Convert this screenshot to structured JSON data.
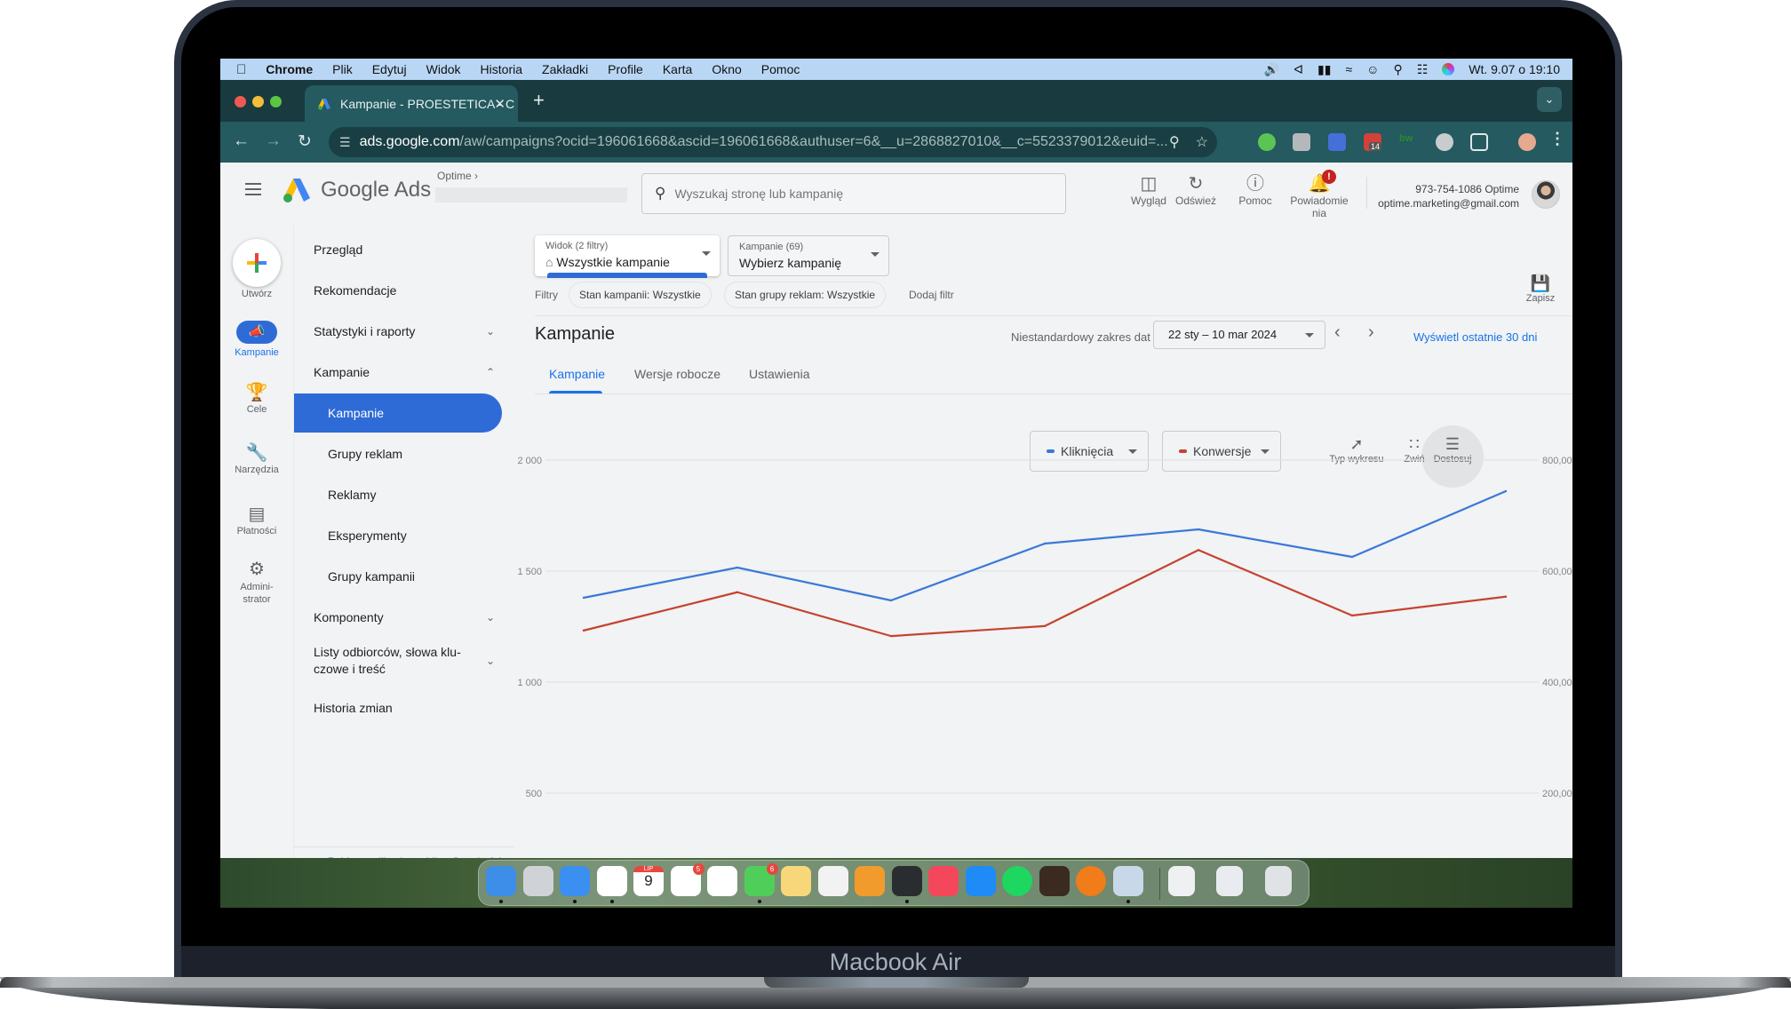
{
  "device": {
    "label": "Macbook Air"
  },
  "menubar": {
    "app": "Chrome",
    "items": [
      "Plik",
      "Edytuj",
      "Widok",
      "Historia",
      "Zakładki",
      "Profile",
      "Karta",
      "Okno",
      "Pomoc"
    ],
    "clock": "Wt. 9.07 o 19:10",
    "status_icons": [
      "volume-icon",
      "bluetooth-icon",
      "battery-icon",
      "wifi-icon",
      "user-icon",
      "spotlight-icon",
      "control-center-icon",
      "siri-icon"
    ]
  },
  "browser": {
    "tab_title": "Kampanie - PROESTETICA - C",
    "url_domain": "ads.google.com",
    "url_rest": "/aw/campaigns?ocid=196061668&ascid=196061668&authuser=6&__u=2868827010&__c=5523379012&euid=...",
    "extension_badge": "14"
  },
  "ads_header": {
    "product": "Google Ads",
    "account_label": "Optime",
    "search_placeholder": "Wyszukaj stronę lub kampanię",
    "buttons": [
      {
        "label": "Wygląd",
        "icon": "appearance-icon"
      },
      {
        "label": "Odśwież",
        "icon": "refresh-icon"
      },
      {
        "label": "Pomoc",
        "icon": "help-icon"
      },
      {
        "label": "Powiadomienia",
        "label_line1": "Powiadomie",
        "label_line2": "nia",
        "icon": "bell-icon",
        "badge": "!"
      }
    ],
    "user_line1": "973-754-1086 Optime",
    "user_email": "optime.marketing@gmail.com"
  },
  "rail": {
    "items": [
      {
        "label": "Utwórz",
        "icon": "create-plus-icon"
      },
      {
        "label": "Kampanie",
        "icon": "megaphone-icon",
        "active": true
      },
      {
        "label": "Cele",
        "icon": "trophy-icon"
      },
      {
        "label": "Narzędzia",
        "icon": "tools-icon"
      },
      {
        "label": "Płatności",
        "icon": "credit-card-icon"
      },
      {
        "label_line1": "Admini-",
        "label_line2": "strator",
        "icon": "gear-icon"
      }
    ]
  },
  "nav": {
    "items": [
      {
        "label": "Przegląd"
      },
      {
        "label": "Rekomendacje"
      },
      {
        "label": "Statystyki i raporty",
        "chevron": "down"
      },
      {
        "label": "Kampanie",
        "chevron": "up"
      },
      {
        "label": "Kampanie",
        "sub": true,
        "active": true
      },
      {
        "label": "Grupy reklam",
        "sub": true
      },
      {
        "label": "Reklamy",
        "sub": true
      },
      {
        "label": "Eksperymenty",
        "sub": true
      },
      {
        "label": "Grupy kampanii",
        "sub": true
      },
      {
        "label": "Komponenty",
        "chevron": "down"
      },
      {
        "label_line1": "Listy odbiorców, słowa klu-",
        "label_line2": "czowe i treść",
        "chevron": "down"
      },
      {
        "label": "Historia zmian"
      }
    ],
    "mobile_app_link": "Pobierz aplikację mobilną Google Ads"
  },
  "main": {
    "view_selector": {
      "label": "Widok (2 filtry)",
      "value": "Wszystkie kampanie"
    },
    "campaign_selector": {
      "label": "Kampanie (69)",
      "value": "Wybierz kampanię"
    },
    "filters_label": "Filtry",
    "filter_chips": [
      "Stan kampanii: Wszystkie",
      "Stan grupy reklam: Wszystkie"
    ],
    "add_filter": "Dodaj filtr",
    "save_label": "Zapisz",
    "page_title": "Kampanie",
    "date_range_label": "Niestandardowy zakres dat",
    "date_range_value": "22 sty – 10 mar 2024",
    "last_30_link": "Wyświetl ostatnie 30 dni",
    "tabs": [
      {
        "label": "Kampanie",
        "active": true
      },
      {
        "label": "Wersje robocze"
      },
      {
        "label": "Ustawienia"
      }
    ],
    "metrics": [
      {
        "label": "Kliknięcia",
        "color": "#3b78d8"
      },
      {
        "label": "Konwersje",
        "color": "#c5432f"
      }
    ],
    "chart_tools": [
      {
        "label": "Typ wykresu",
        "icon": "chart-type-icon"
      },
      {
        "label": "Zwiń",
        "icon": "collapse-icon"
      },
      {
        "label": "Dostosuj",
        "icon": "tune-icon"
      }
    ]
  },
  "chart_data": {
    "type": "line",
    "title": "",
    "xlabel": "",
    "ylabel": "",
    "x": [
      1,
      2,
      3,
      4,
      5,
      6,
      7
    ],
    "left_axis": {
      "ticks": [
        500,
        1000,
        1500,
        2000
      ],
      "tick_labels": [
        "500",
        "1 000",
        "1 500",
        "2 000"
      ],
      "ylim": [
        500,
        2000
      ]
    },
    "right_axis": {
      "ticks": [
        200,
        400,
        600,
        800
      ],
      "tick_labels": [
        "200,00",
        "400,00",
        "600,00",
        "800,00"
      ],
      "ylim": [
        200,
        800
      ]
    },
    "grid": true,
    "series": [
      {
        "name": "Kliknięcia",
        "axis": "left",
        "color": "#3b78d8",
        "values": [
          1380,
          1516,
          1368,
          1624,
          1688,
          1564,
          1860
        ]
      },
      {
        "name": "Konwersje",
        "axis": "right",
        "color": "#c5432f",
        "values": [
          493,
          562,
          483,
          501,
          638,
          520,
          554
        ]
      }
    ]
  },
  "dock": {
    "apps": [
      "Finder",
      "Launchpad",
      "Safari",
      "Chrome",
      "Kalendarz",
      "Przypomnienia",
      "Zdjęcia",
      "Wiadomości",
      "Notatki",
      "TextEdit",
      "Pages",
      "Giełda",
      "Muzyka",
      "App Store",
      "Spotify",
      "GarageBand",
      "FL Studio",
      "Podgląd"
    ],
    "calendar_month": "LIP",
    "calendar_day": "9",
    "reminders_badge": "5",
    "messages_badge": "6"
  }
}
